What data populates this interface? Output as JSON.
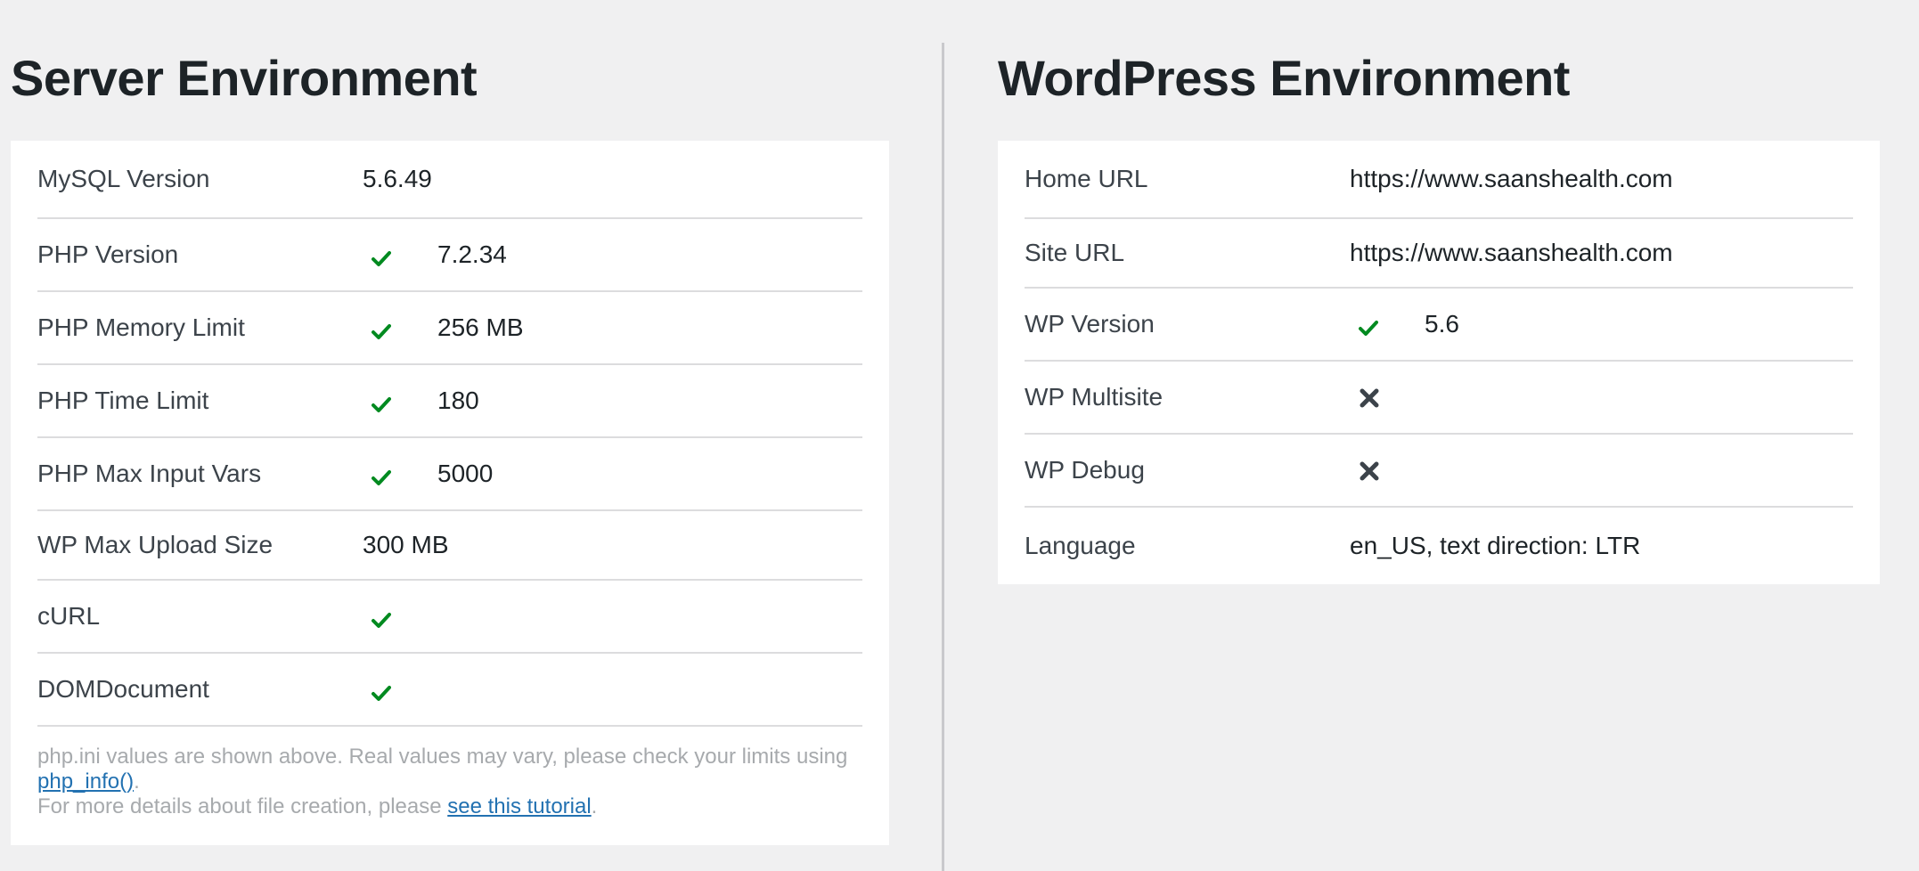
{
  "server": {
    "title": "Server Environment",
    "rows": [
      {
        "label": "MySQL Version",
        "value": "5.6.49",
        "status": "none"
      },
      {
        "label": "PHP Version",
        "value": "7.2.34",
        "status": "ok"
      },
      {
        "label": "PHP Memory Limit",
        "value": "256 MB",
        "status": "ok"
      },
      {
        "label": "PHP Time Limit",
        "value": "180",
        "status": "ok"
      },
      {
        "label": "PHP Max Input Vars",
        "value": "5000",
        "status": "ok"
      },
      {
        "label": "WP Max Upload Size",
        "value": "300 MB",
        "status": "none"
      },
      {
        "label": "cURL",
        "value": "",
        "status": "ok"
      },
      {
        "label": "DOMDocument",
        "value": "",
        "status": "ok"
      }
    ],
    "note": {
      "line1_text": "php.ini values are shown above. Real values may vary, please check your limits using ",
      "line1_link": "php_info()",
      "line1_end": ".",
      "line2_text": "For more details about file creation, please ",
      "line2_link": "see this tutorial",
      "line2_end": "."
    }
  },
  "wordpress": {
    "title": "WordPress Environment",
    "rows": [
      {
        "label": "Home URL",
        "value": "https://www.saanshealth.com",
        "status": "none"
      },
      {
        "label": "Site URL",
        "value": "https://www.saanshealth.com",
        "status": "none"
      },
      {
        "label": "WP Version",
        "value": "5.6",
        "status": "ok"
      },
      {
        "label": "WP Multisite",
        "value": "",
        "status": "no"
      },
      {
        "label": "WP Debug",
        "value": "",
        "status": "no"
      },
      {
        "label": "Language",
        "value": "en_US, text direction: LTR",
        "status": "none"
      }
    ]
  },
  "colors": {
    "check": "#008a20",
    "cross": "#3c434a",
    "link": "#2271b1"
  },
  "icons": {
    "ok": "check-icon",
    "no": "x-icon"
  }
}
